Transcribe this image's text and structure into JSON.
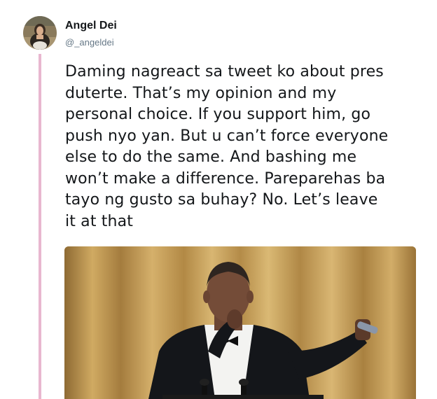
{
  "tweet": {
    "author": {
      "display_name": "Angel Dei",
      "handle": "@_angeldei",
      "avatar_icon": "user-avatar-photo"
    },
    "text": "Daming nagreact sa tweet ko about pres\nduterte. That’s my opinion and my\npersonal choice. If you support him, go\npush nyo yan. But u can’t force everyone\nelse to do the same. And bashing me\nwon’t make a difference. Pareparehas ba\ntayo ng gusto sa buhay? No. Let’s leave\nit at that",
    "media": {
      "type": "gif-image",
      "icon": "man-at-podium-mic-drop-image"
    },
    "colors": {
      "thread_line": "#e8b7cf",
      "handle": "#657786",
      "text": "#14171a"
    }
  }
}
